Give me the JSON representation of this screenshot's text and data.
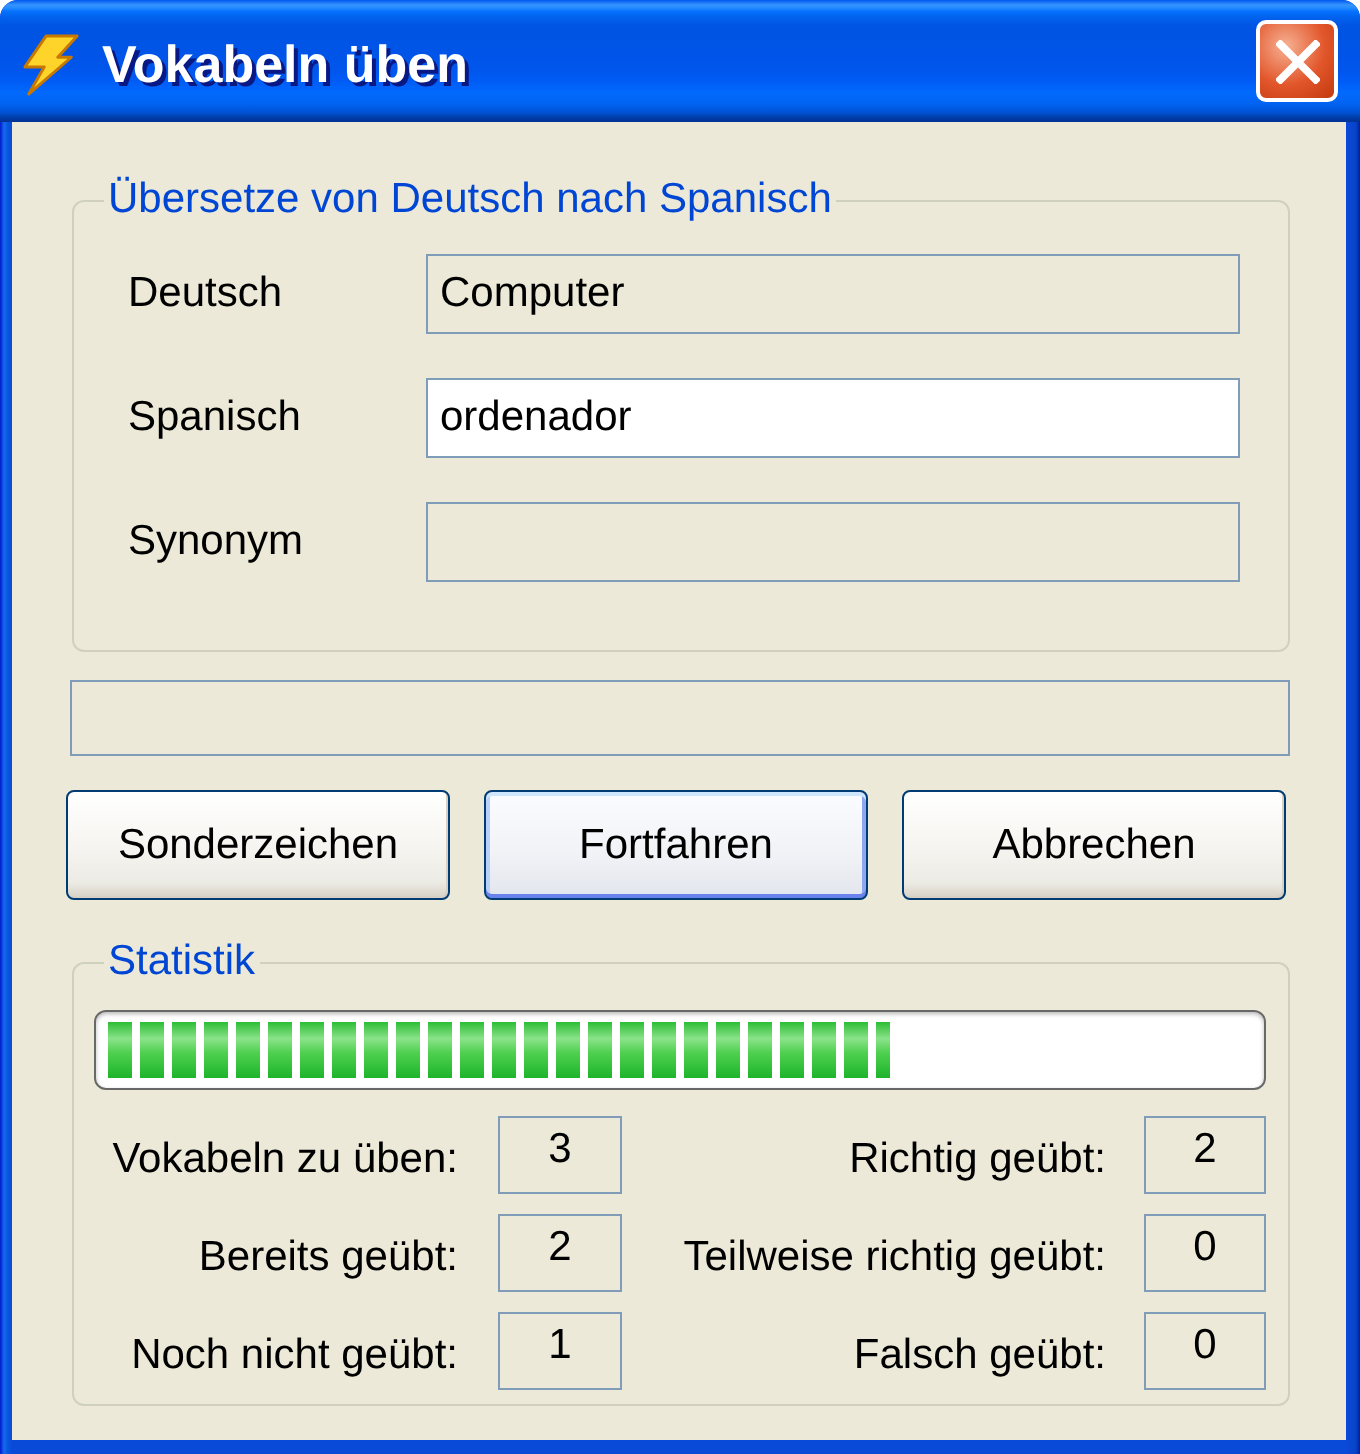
{
  "window": {
    "title": "Vokabeln üben"
  },
  "translation_group": {
    "legend": "Übersetze von Deutsch nach Spanisch",
    "fields": [
      {
        "label": "Deutsch",
        "value": "Computer",
        "read_only": true
      },
      {
        "label": "Spanisch",
        "value": "ordenador",
        "read_only": false
      },
      {
        "label": "Synonym",
        "read_only": true
      }
    ]
  },
  "message_field": {
    "read_only": true
  },
  "buttons": [
    {
      "label": "Sonderzeichen",
      "default": false
    },
    {
      "label": "Fortfahren",
      "default": true
    },
    {
      "label": "Abbrechen",
      "default": false
    }
  ],
  "statistics": {
    "legend": "Statistik",
    "progress": {
      "level": 0.68
    },
    "counters": [
      {
        "label": "Vokabeln zu üben:",
        "value": "3"
      },
      {
        "label": "Richtig geübt:",
        "value": "2"
      },
      {
        "label": "Bereits geübt:",
        "value": "2"
      },
      {
        "label": "Teilweise richtig geübt:",
        "value": "0"
      },
      {
        "label": "Noch nicht geübt:",
        "value": "1"
      },
      {
        "label": "Falsch geübt:",
        "value": "0"
      }
    ]
  }
}
